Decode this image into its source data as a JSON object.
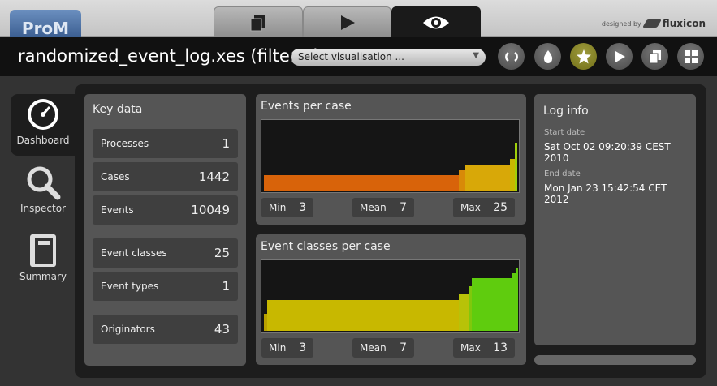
{
  "app": {
    "logo_text": "ProM",
    "credit_prefix": "designed by",
    "credit_brand": "fluxicon"
  },
  "tabs": [
    {
      "icon": "copy-icon"
    },
    {
      "icon": "play-icon"
    },
    {
      "icon": "eye-icon",
      "active": true
    }
  ],
  "header": {
    "title": "randomized_event_log.xes (filtered",
    "visualisation_select": "Select visualisation ...",
    "toolbar": [
      "refresh-icon",
      "drop-icon",
      "star-icon",
      "play-icon",
      "copy-icon",
      "grid-icon"
    ]
  },
  "sidebar": [
    {
      "label": "Dashboard",
      "icon": "gauge-icon",
      "active": true
    },
    {
      "label": "Inspector",
      "icon": "magnifier-icon"
    },
    {
      "label": "Summary",
      "icon": "notebook-icon"
    }
  ],
  "key_data": {
    "title": "Key data",
    "rows": [
      {
        "label": "Processes",
        "value": "1"
      },
      {
        "label": "Cases",
        "value": "1442"
      },
      {
        "label": "Events",
        "value": "10049"
      },
      {
        "label": "Event classes",
        "value": "25"
      },
      {
        "label": "Event types",
        "value": "1"
      },
      {
        "label": "Originators",
        "value": "43"
      }
    ]
  },
  "events_per_case": {
    "title": "Events per case",
    "min_label": "Min",
    "min": "3",
    "mean_label": "Mean",
    "mean": "7",
    "max_label": "Max",
    "max": "25"
  },
  "event_classes_per_case": {
    "title": "Event classes per case",
    "min_label": "Min",
    "min": "3",
    "mean_label": "Mean",
    "mean": "7",
    "max_label": "Max",
    "max": "13"
  },
  "log_info": {
    "title": "Log info",
    "start_label": "Start date",
    "start_value": "Sat Oct 02 09:20:39 CEST 2010",
    "end_label": "End date",
    "end_value": "Mon Jan 23 15:42:54 CET 2012"
  },
  "colors": {
    "orange": "#d8630a",
    "yellow": "#c8b800",
    "green": "#5fcc0e",
    "star_button": "#8c8a28"
  }
}
